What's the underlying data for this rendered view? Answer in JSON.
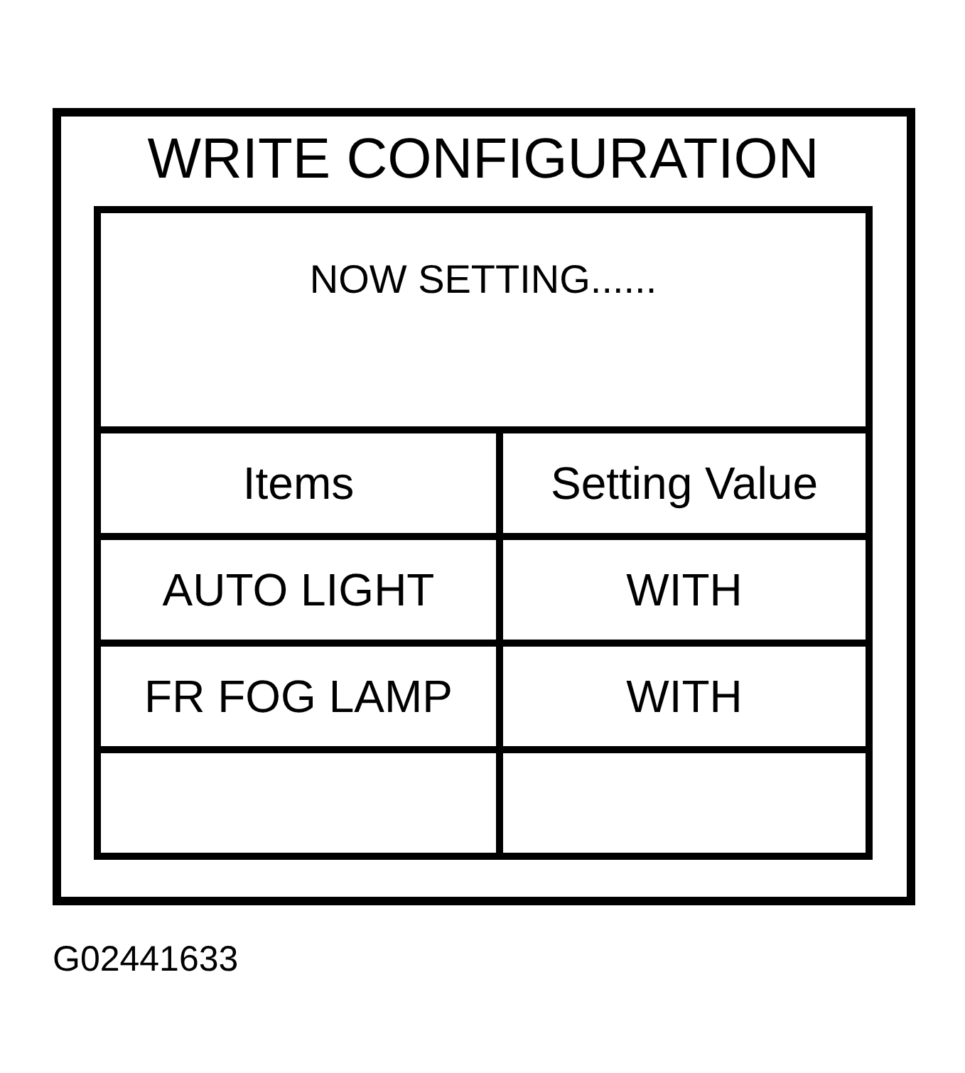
{
  "panel": {
    "title": "WRITE CONFIGURATION",
    "status": "NOW SETTING......",
    "table": {
      "columns": [
        "Items",
        "Setting Value"
      ],
      "rows": [
        {
          "kind": "entry",
          "cells": [
            "AUTO LIGHT",
            "WITH"
          ]
        },
        {
          "kind": "entry",
          "cells": [
            "FR FOG LAMP",
            "WITH"
          ]
        },
        {
          "kind": "blank"
        }
      ]
    }
  },
  "figure_code": "G02441633"
}
